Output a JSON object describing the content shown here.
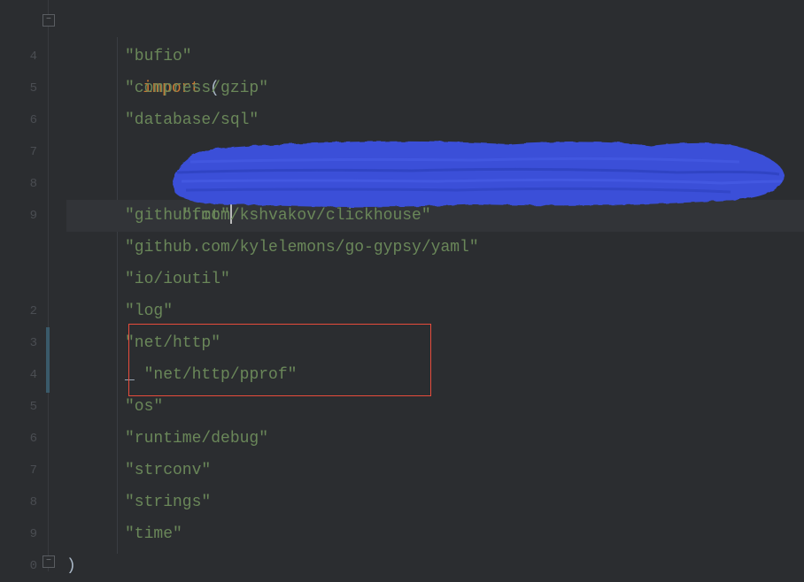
{
  "gutter": {
    "numbers": [
      "",
      "4",
      "5",
      "6",
      "7",
      "8",
      "9",
      "",
      "",
      "2",
      "3",
      "4",
      "5",
      "6",
      "7",
      "8",
      "9",
      "0"
    ]
  },
  "code": {
    "keyword_import": "import",
    "open_paren": " (",
    "close_paren": ")",
    "blank_ident": "_",
    "lines": [
      {
        "text": "\"bufio\""
      },
      {
        "text": "\"compress/gzip\""
      },
      {
        "text": "\"database/sql\""
      },
      {
        "text": "\"fmt\""
      },
      {
        "text": ""
      },
      {
        "text": "\"github.com/kshvakov/clickhouse\""
      },
      {
        "text": "\"github.com/kylelemons/go-gypsy/yaml\""
      },
      {
        "text": "\"io/ioutil\""
      },
      {
        "text": "\"log\""
      },
      {
        "text": "\"net/http\""
      },
      {
        "text": "\"net/http/pprof\"",
        "blank": true
      },
      {
        "text": "\"os\""
      },
      {
        "text": "\"runtime/debug\""
      },
      {
        "text": "\"strconv\""
      },
      {
        "text": "\"strings\""
      },
      {
        "text": "\"time\""
      }
    ]
  },
  "annotations": {
    "red_box": "highlight-pprof-imports",
    "blue_stroke": "redaction-stroke"
  }
}
